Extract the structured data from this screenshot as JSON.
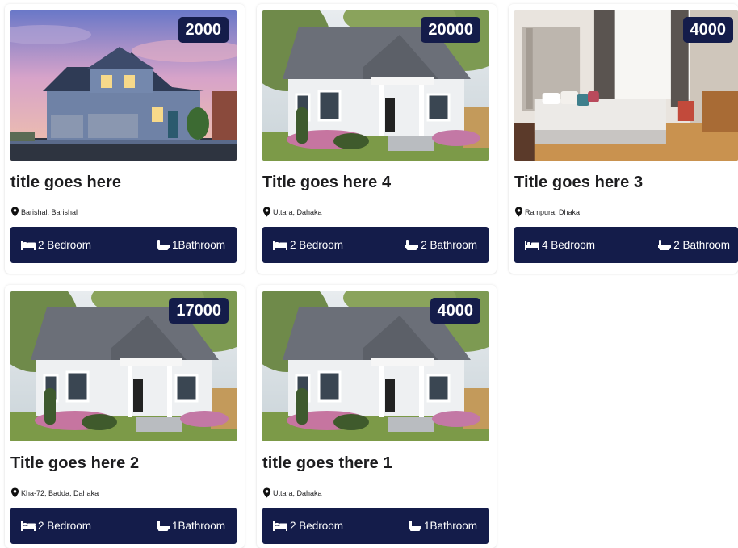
{
  "listings": [
    {
      "price": "2000",
      "title": "title goes here",
      "location": "Barishal, Barishal",
      "bedrooms": "2 Bedroom",
      "bathrooms": "1Bathroom",
      "image": "modern-house-dusk-photo"
    },
    {
      "price": "20000",
      "title": "Title goes here 4",
      "location": "Uttara, Dahaka",
      "bedrooms": "2 Bedroom",
      "bathrooms": "2 Bathroom",
      "image": "white-cottage-photo"
    },
    {
      "price": "4000",
      "title": "Title goes here 3",
      "location": "Rampura, Dhaka",
      "bedrooms": "4 Bedroom",
      "bathrooms": "2 Bathroom",
      "image": "bedroom-interior-photo"
    },
    {
      "price": "17000",
      "title": "Title goes here 2",
      "location": "Kha-72, Badda, Dahaka",
      "bedrooms": "2 Bedroom",
      "bathrooms": "1Bathroom",
      "image": "white-cottage-photo"
    },
    {
      "price": "4000",
      "title": "title goes there 1",
      "location": "Uttara, Dahaka",
      "bedrooms": "2 Bedroom",
      "bathrooms": "1Bathroom",
      "image": "white-cottage-photo"
    }
  ],
  "icons": {
    "location": "map-pin-icon",
    "bedroom": "bed-icon",
    "bathroom": "bathtub-icon"
  },
  "colors": {
    "accent": "#141c4a",
    "text": "#1d1d1f",
    "background": "#ffffff"
  }
}
